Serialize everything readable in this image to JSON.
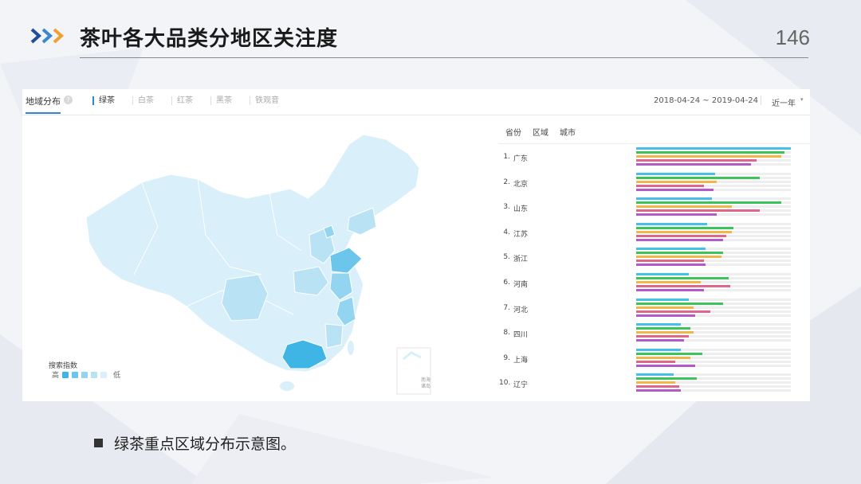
{
  "slide": {
    "title": "茶叶各大品类分地区关注度",
    "page_number": "146",
    "caption": "绿茶重点区域分布示意图。",
    "accent_colors": [
      "#1f4e9a",
      "#3a86d0",
      "#f0a030"
    ]
  },
  "panel": {
    "main_tab": "地域分布",
    "help_icon": "question-icon",
    "subtabs": [
      {
        "label": "绿茶",
        "active": true
      },
      {
        "label": "白茶",
        "active": false
      },
      {
        "label": "红茶",
        "active": false
      },
      {
        "label": "黑茶",
        "active": false
      },
      {
        "label": "铁观音",
        "active": false
      }
    ],
    "date_range": "2018-04-24 ~ 2019-04-24",
    "period": "近一年",
    "period_caret": "▾"
  },
  "map": {
    "legend_title": "搜索指数",
    "legend_high": "高",
    "legend_low": "低",
    "legend_colors": [
      "#3fb5e6",
      "#6cc6ec",
      "#93d5f1",
      "#b9e2f5",
      "#d9eff9"
    ],
    "inset_label": "南海诸岛",
    "highlight_color": "#3fb5e6",
    "base_color": "#d9eff9"
  },
  "ranking": {
    "tabs": [
      "省份",
      "区域",
      "城市"
    ],
    "series_colors": [
      "#45c1e8",
      "#3cc35a",
      "#f0b64a",
      "#e0658a",
      "#b45ac6"
    ],
    "rows": [
      {
        "rank": "1.",
        "name": "广东",
        "values": [
          1.0,
          0.96,
          0.94,
          0.78,
          0.74
        ]
      },
      {
        "rank": "2.",
        "name": "北京",
        "values": [
          0.51,
          0.8,
          0.52,
          0.44,
          0.5
        ]
      },
      {
        "rank": "3.",
        "name": "山东",
        "values": [
          0.49,
          0.94,
          0.62,
          0.8,
          0.52
        ]
      },
      {
        "rank": "4.",
        "name": "江苏",
        "values": [
          0.46,
          0.63,
          0.62,
          0.58,
          0.56
        ]
      },
      {
        "rank": "5.",
        "name": "浙江",
        "values": [
          0.45,
          0.56,
          0.55,
          0.44,
          0.45
        ]
      },
      {
        "rank": "6.",
        "name": "河南",
        "values": [
          0.34,
          0.6,
          0.42,
          0.61,
          0.44
        ]
      },
      {
        "rank": "7.",
        "name": "河北",
        "values": [
          0.34,
          0.56,
          0.37,
          0.48,
          0.38
        ]
      },
      {
        "rank": "8.",
        "name": "四川",
        "values": [
          0.29,
          0.35,
          0.37,
          0.34,
          0.31
        ]
      },
      {
        "rank": "9.",
        "name": "上海",
        "values": [
          0.29,
          0.43,
          0.35,
          0.25,
          0.38
        ]
      },
      {
        "rank": "10.",
        "name": "辽宁",
        "values": [
          0.24,
          0.39,
          0.25,
          0.28,
          0.29
        ]
      }
    ]
  }
}
